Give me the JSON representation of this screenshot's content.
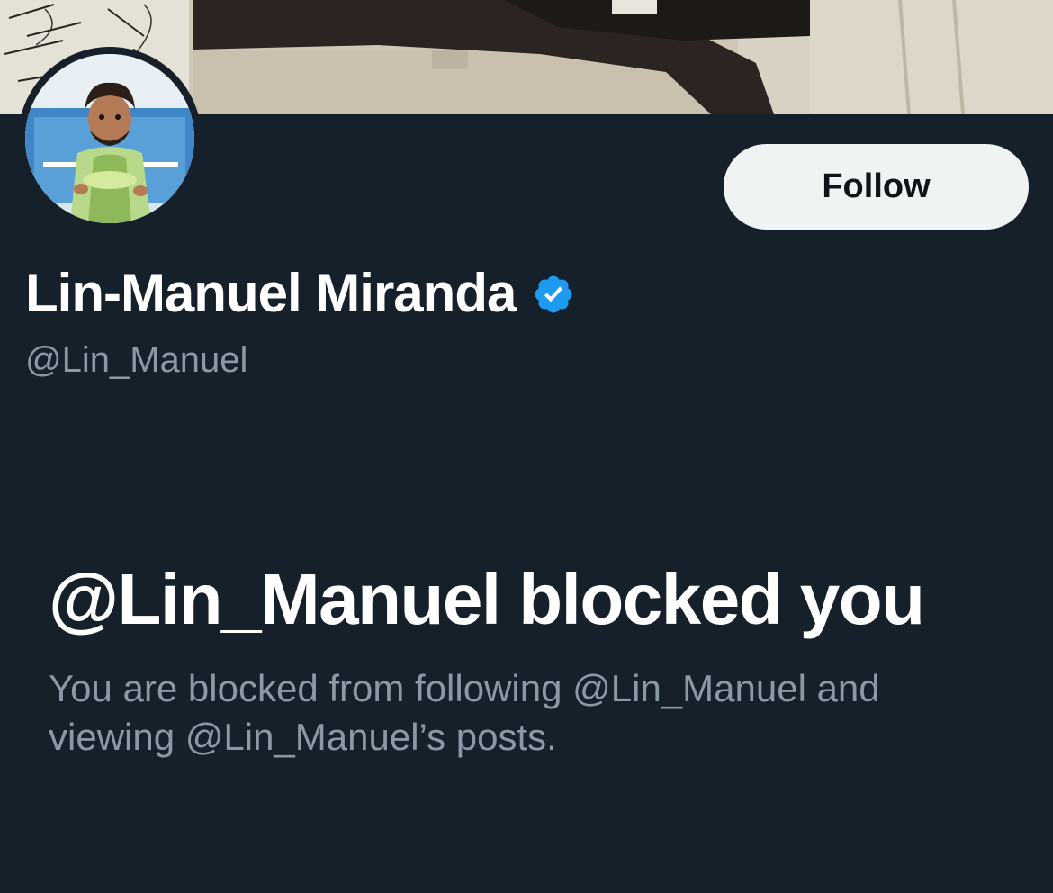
{
  "profile": {
    "display_name": "Lin-Manuel Miranda",
    "handle": "@Lin_Manuel",
    "verified": true,
    "verified_icon": "verified-badge-icon",
    "avatar_icon": "profile-avatar",
    "banner_icon": "profile-banner"
  },
  "actions": {
    "follow_label": "Follow"
  },
  "blocked": {
    "title": "@Lin_Manuel blocked you",
    "message": "You are blocked from following @Lin_Manuel and viewing @Lin_Manuel’s posts."
  },
  "colors": {
    "background": "#15202b",
    "primary_text": "#ffffff",
    "secondary_text": "#8b98a5",
    "button_bg": "#eff3f4",
    "verified_blue": "#1d9bf0"
  }
}
